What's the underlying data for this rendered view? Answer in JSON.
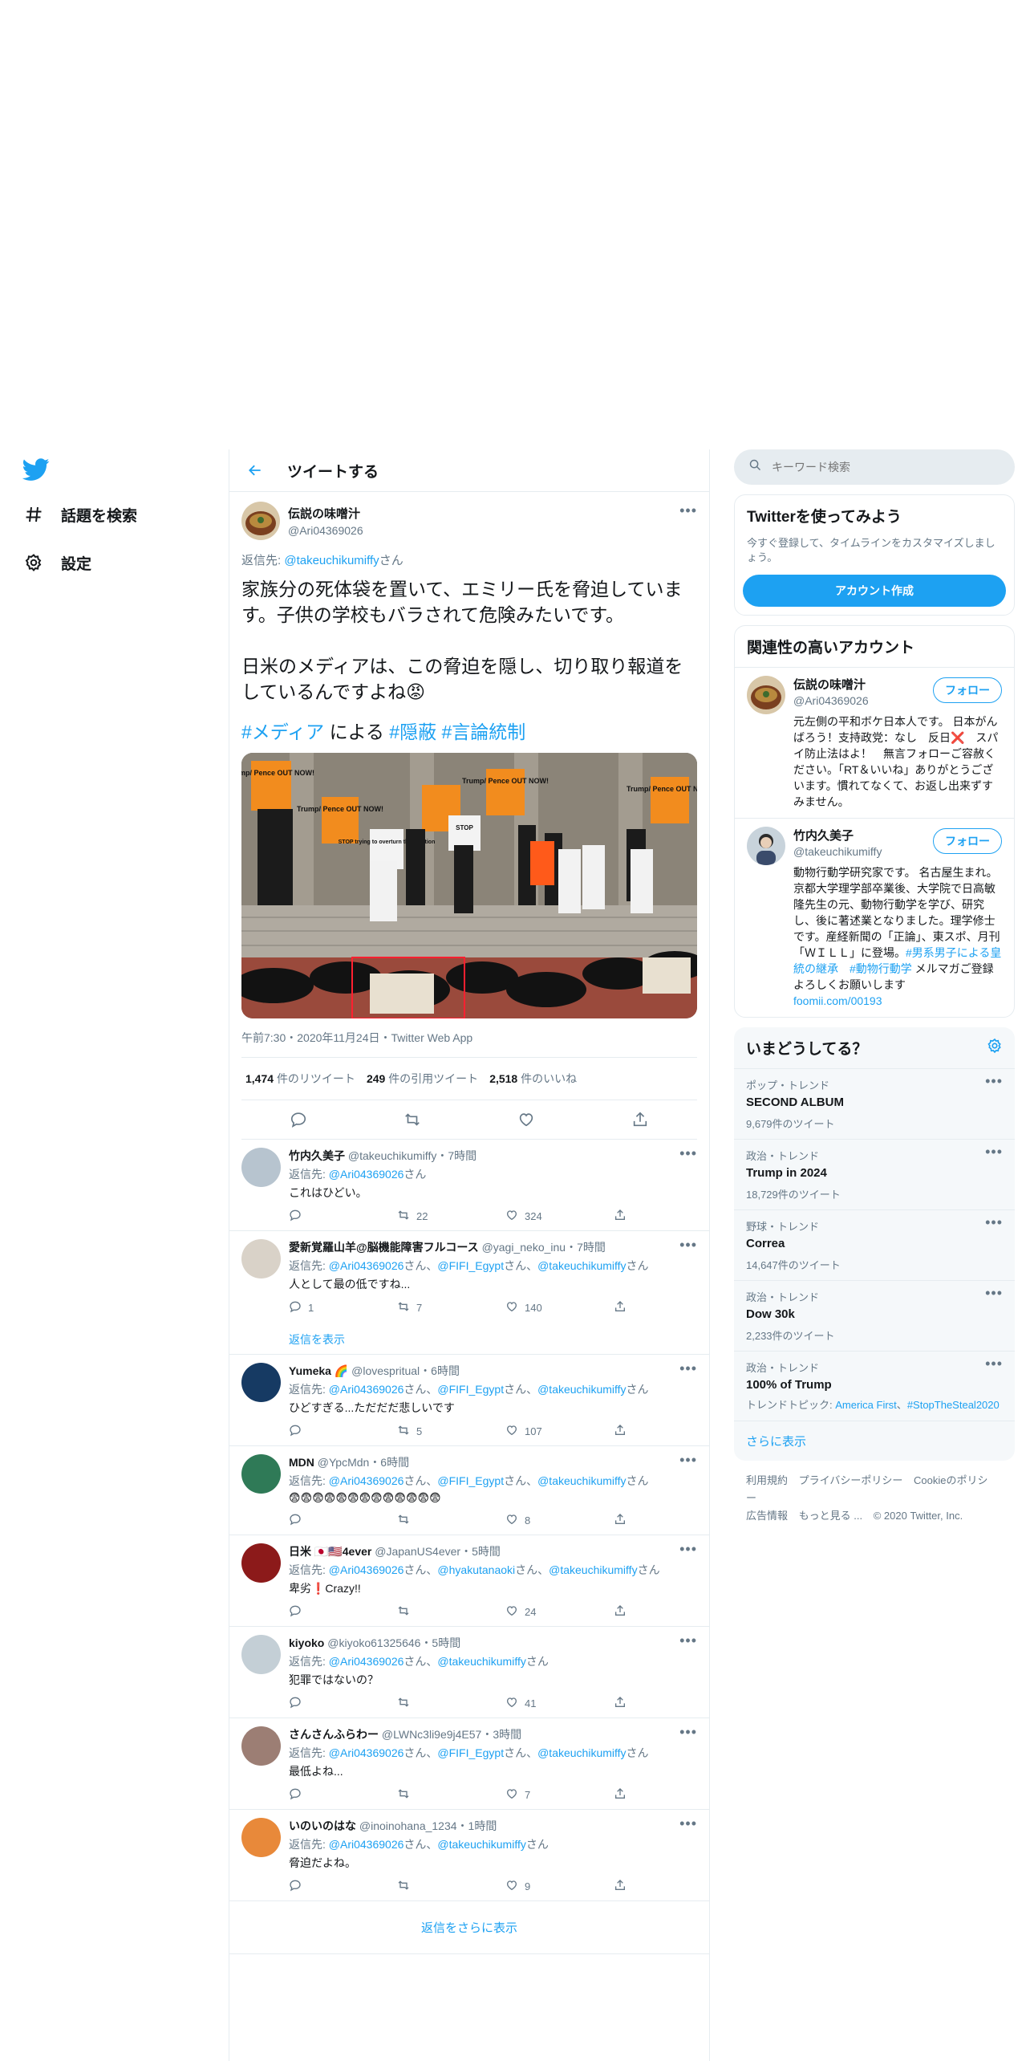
{
  "nav": {
    "items": [
      {
        "label": "話題を検索"
      },
      {
        "label": "設定"
      }
    ]
  },
  "header": {
    "title": "ツイートする"
  },
  "main_tweet": {
    "name": "伝説の味噌汁",
    "handle": "@Ari04369026",
    "reply_to_handle": "@takeuchikumiffy",
    "reply_to_prefix": "返信先: ",
    "reply_to_suffix": "さん",
    "text": "家族分の死体袋を置いて、エミリー氏を脅迫しています。子供の学校もバラされて危険みたいです。\n\n日米のメディアは、この脅迫を隠し、切り取り報道をしているんですよね😡",
    "tag1": "#メディア",
    "tag_join": " による ",
    "tag2": "#隠蔽",
    "tag3": "#言論統制",
    "image_signs": [
      "Trump/ Pence OUT NOW!",
      "Trump/ Pence OUT NOW!",
      "STOP trying to overturn the Election",
      "STOP",
      "Trump/ Pence OUT NOW!",
      "Trump/ Pence OUT NOW!"
    ],
    "timestamp": "午前7:30・2020年11月24日・Twitter Web App",
    "stats": {
      "retweets": "1,474",
      "retweets_label": "件のリツイート",
      "quotes": "249",
      "quotes_label": "件の引用ツイート",
      "likes": "2,518",
      "likes_label": "件のいいね"
    }
  },
  "replies": [
    {
      "name": "竹内久美子",
      "handle": "@takeuchikumiffy",
      "time": "・7時間",
      "reply_to": [
        "@Ari04369026"
      ],
      "text": "これはひどい。",
      "comments": "",
      "retweets": "22",
      "likes": "324",
      "avatar_color": "#b7c4cf"
    },
    {
      "name": "愛新覚羅山羊@脳機能障害フルコース",
      "handle": "@yagi_neko_inu",
      "time": "・7時間",
      "reply_to": [
        "@Ari04369026",
        "@FIFI_Egypt",
        "@takeuchikumiffy"
      ],
      "text": "人として最の低ですね...",
      "comments": "1",
      "retweets": "7",
      "likes": "140",
      "avatar_color": "#d9d2c8",
      "show_thread": "返信を表示"
    },
    {
      "name": "Yumeka 🌈",
      "handle": "@lovespritual",
      "time": "・6時間",
      "reply_to": [
        "@Ari04369026",
        "@FIFI_Egypt",
        "@takeuchikumiffy"
      ],
      "text": "ひどすぎる...ただだだ悲しいです",
      "comments": "",
      "retweets": "5",
      "likes": "107",
      "avatar_color": "#163a63"
    },
    {
      "name": "MDN",
      "handle": "@YpcMdn",
      "time": "・6時間",
      "reply_to": [
        "@Ari04369026",
        "@FIFI_Egypt",
        "@takeuchikumiffy"
      ],
      "text": "😨😨😨😨😨😨😨😨😨😨😨😨😨",
      "comments": "",
      "retweets": "",
      "likes": "8",
      "avatar_color": "#2f7a57"
    },
    {
      "name": "日米 🇯🇵🇺🇸4ever",
      "handle": "@JapanUS4ever",
      "time": "・5時間",
      "reply_to": [
        "@Ari04369026",
        "@hyakutanaoki",
        "@takeuchikumiffy"
      ],
      "text": "卑劣❗Crazy!!",
      "comments": "",
      "retweets": "",
      "likes": "24",
      "avatar_color": "#8c1a1a"
    },
    {
      "name": "kiyoko",
      "handle": "@kiyoko61325646",
      "time": "・5時間",
      "reply_to": [
        "@Ari04369026",
        "@takeuchikumiffy"
      ],
      "text": "犯罪ではないの？",
      "comments": "",
      "retweets": "",
      "likes": "41",
      "avatar_color": "#c4cfd6"
    },
    {
      "name": "さんさんふらわー",
      "handle": "@LWNc3li9e9j4E57",
      "time": "・3時間",
      "reply_to": [
        "@Ari04369026",
        "@FIFI_Egypt",
        "@takeuchikumiffy"
      ],
      "text": "最低よね...",
      "comments": "",
      "retweets": "",
      "likes": "7",
      "avatar_color": "#9c7e74"
    },
    {
      "name": "いのいのはな",
      "handle": "@inoinohana_1234",
      "time": "・1時間",
      "reply_to": [
        "@Ari04369026",
        "@takeuchikumiffy"
      ],
      "text": "脅迫だよね。",
      "comments": "",
      "retweets": "",
      "likes": "9",
      "avatar_color": "#e8893a"
    }
  ],
  "reply_labels": {
    "prefix": "返信先: ",
    "suffix": "さん",
    "sep": "、"
  },
  "show_more_replies": "返信をさらに表示",
  "sidebar": {
    "search_placeholder": "キーワード検索",
    "signup": {
      "title": "Twitterを使ってみよう",
      "desc": "今すぐ登録して、タイムラインをカスタマイズしましょう。",
      "button": "アカウント作成"
    },
    "related": {
      "title": "関連性の高いアカウント",
      "follow_label": "フォロー",
      "accounts": [
        {
          "name": "伝説の味噌汁",
          "handle": "@Ari04369026",
          "bio": "元左側の平和ボケ日本人です。 日本がんばろう！支持政党：なし　反日❌　スパイ防止法はよ！　無言フォローご容赦ください。「RT＆いいね」ありがとうございます。慣れてなくて、お返し出来ずすみません。"
        },
        {
          "name": "竹内久美子",
          "handle": "@takeuchikumiffy",
          "bio": "動物行動学研究家です。 名古屋生まれ。京都大学理学部卒業後、大学院で日高敏隆先生の元、動物行動学を学び、研究し、後に著述業となりました。理学修士です。産経新聞の「正論」、東スポ、月刊「ＷＩＬＬ」に登場。",
          "bio_tag1": "#男系男子による皇統の継承",
          "bio_tag2": "#動物行動学",
          "bio_tail": " メルマガご登録よろしくお願いします　",
          "bio_link": "foomii.com/00193"
        }
      ]
    },
    "trends": {
      "title": "いまどうしてる？",
      "items": [
        {
          "category": "ポップ・トレンド",
          "name": "SECOND ALBUM",
          "count": "9,679件のツイート"
        },
        {
          "category": "政治・トレンド",
          "name": "Trump in 2024",
          "count": "18,729件のツイート"
        },
        {
          "category": "野球・トレンド",
          "name": "Correa",
          "count": "14,647件のツイート"
        },
        {
          "category": "政治・トレンド",
          "name": "Dow 30k",
          "count": "2,233件のツイート"
        },
        {
          "category": "政治・トレンド",
          "name": "100% of Trump",
          "topic_prefix": "トレンドトピック: ",
          "topic1": "America First",
          "topic_sep": "、",
          "topic2": "#StopTheSteal2020"
        }
      ],
      "show_more": "さらに表示"
    },
    "footer": {
      "links": [
        "利用規約",
        "プライバシーポリシー",
        "Cookieのポリシー",
        "広告情報",
        "もっと見る ..."
      ],
      "copyright": "© 2020 Twitter, Inc."
    }
  },
  "colors": {
    "accent": "#1da1f2",
    "muted": "#657786",
    "border": "#e6ecf0",
    "text": "#14171a"
  }
}
